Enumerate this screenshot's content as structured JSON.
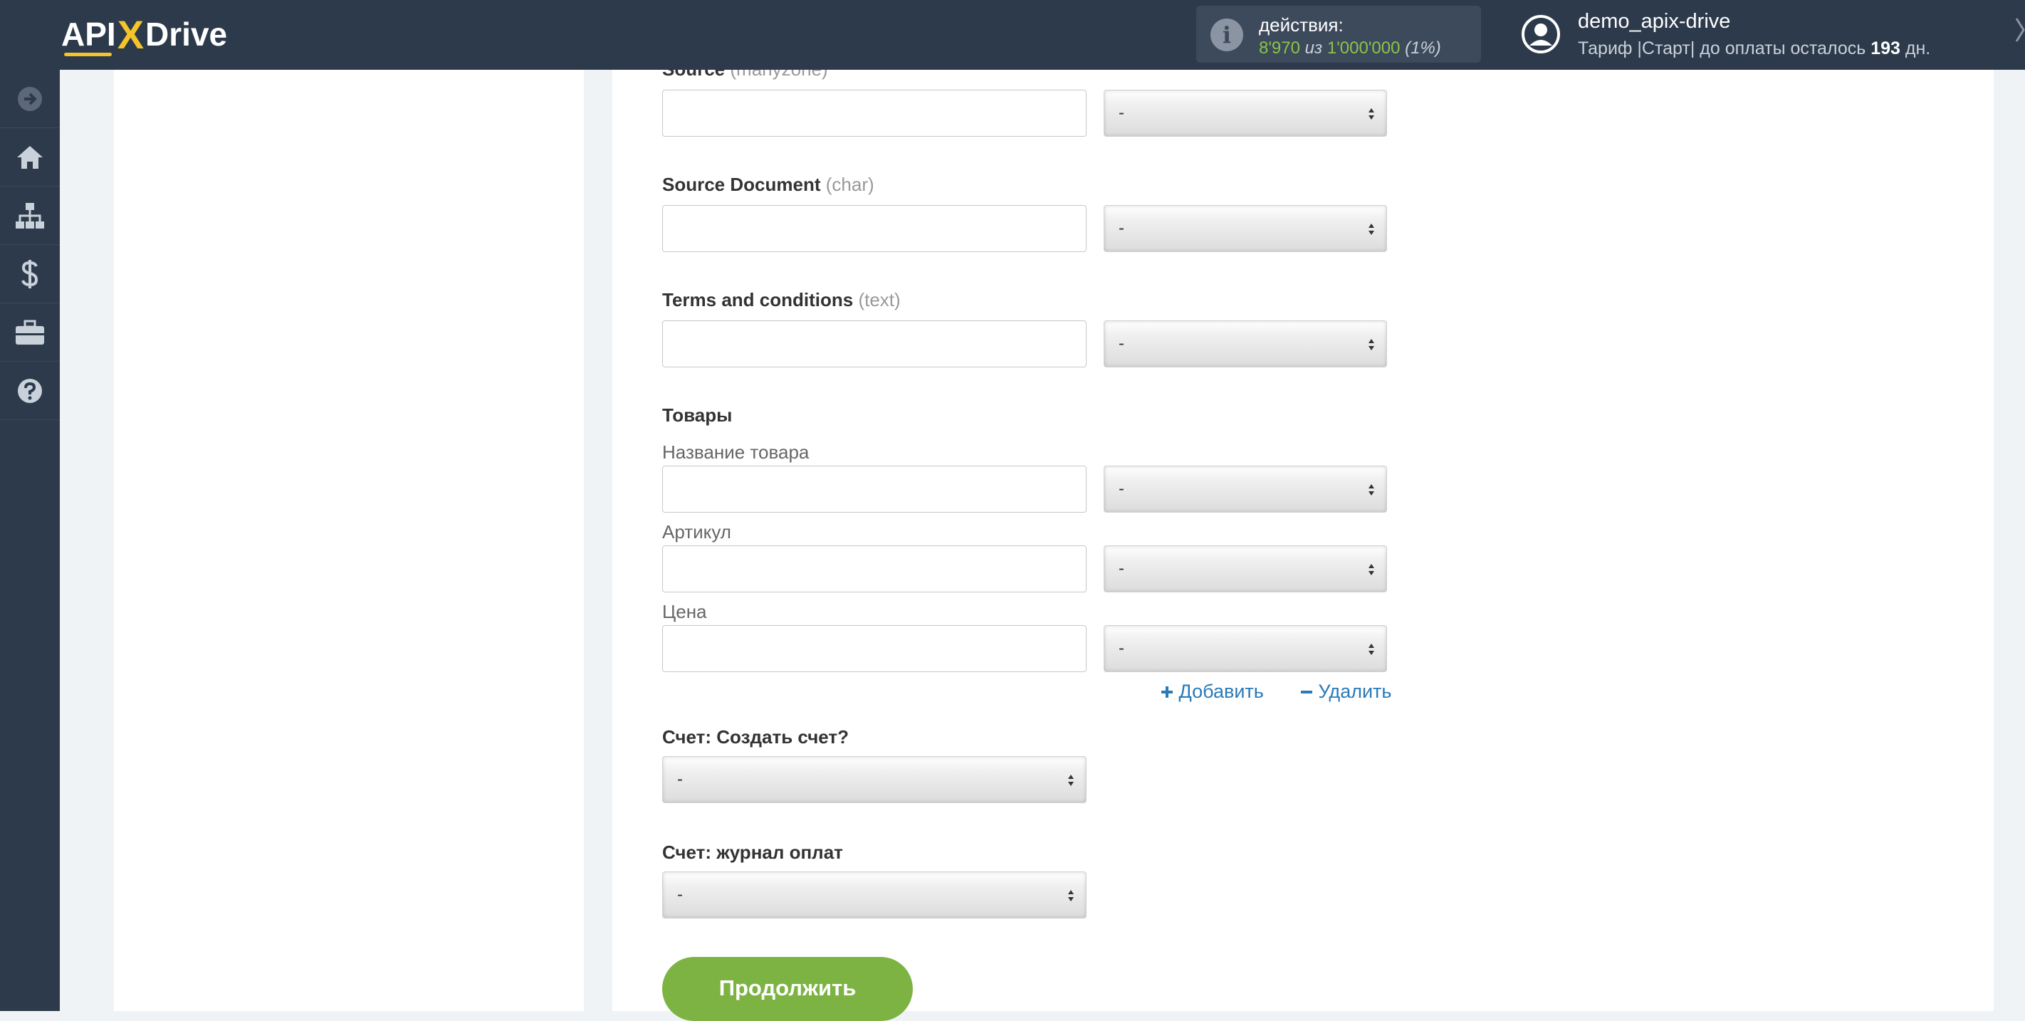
{
  "header": {
    "logo": {
      "part1": "API",
      "part2": "X",
      "part3": "Drive"
    },
    "actions": {
      "label": "действия:",
      "used": "8'970",
      "of": "из",
      "total": "1'000'000",
      "percent": "(1%)"
    },
    "user": {
      "name": "demo_apix-drive",
      "tariff_prefix": "Тариф |Старт| до оплаты осталось",
      "days": "193",
      "days_suffix": "дн."
    }
  },
  "sidebar": {
    "items": [
      {
        "icon": "arrow-right-circle-icon"
      },
      {
        "icon": "home-icon"
      },
      {
        "icon": "sitemap-icon"
      },
      {
        "icon": "dollar-icon"
      },
      {
        "icon": "briefcase-icon"
      },
      {
        "icon": "question-circle-icon"
      }
    ]
  },
  "form": {
    "fields": [
      {
        "label": "Source",
        "type": "(manyzone)",
        "select": "-"
      },
      {
        "label": "Source Document",
        "type": "(char)",
        "select": "-"
      },
      {
        "label": "Terms and conditions",
        "type": "(text)",
        "select": "-"
      }
    ],
    "goods": {
      "title": "Товары",
      "rows": [
        {
          "label": "Название товара",
          "select": "-"
        },
        {
          "label": "Артикул",
          "select": "-"
        },
        {
          "label": "Цена",
          "select": "-"
        }
      ],
      "add_label": "Добавить",
      "remove_label": "Удалить"
    },
    "invoice_create": {
      "label": "Счет: Создать счет?",
      "select": "-"
    },
    "payment_journal": {
      "label": "Счет: журнал оплат",
      "select": "-"
    },
    "continue_label": "Продолжить"
  },
  "colors": {
    "topbar": "#2d3a4b",
    "accent_green": "#7cb342",
    "link_blue": "#2a7ab8",
    "logo_yellow": "#f5c32a"
  }
}
